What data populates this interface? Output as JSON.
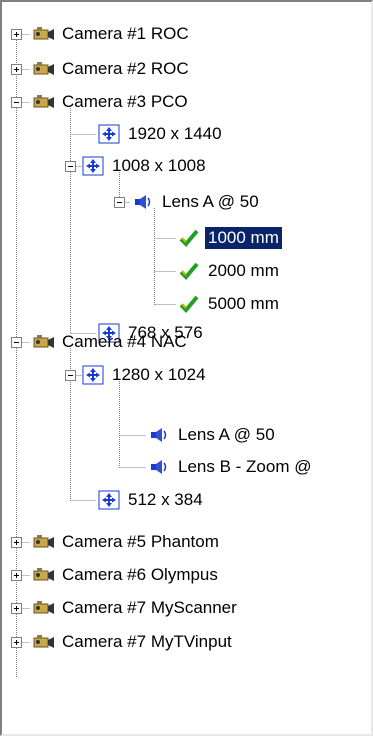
{
  "tree": {
    "cameras": [
      {
        "label": "Camera #1 ROC",
        "expanded": false
      },
      {
        "label": "Camera #2 ROC",
        "expanded": false
      },
      {
        "label": "Camera #3 PCO",
        "expanded": true,
        "resolutions": [
          {
            "label": "1920 x 1440"
          },
          {
            "label": "1008 x 1008",
            "expanded": true,
            "lenses": [
              {
                "label": "Lens A @ 50",
                "expanded": true,
                "distances": [
                  {
                    "label": "1000 mm",
                    "selected": true
                  },
                  {
                    "label": "2000 mm"
                  },
                  {
                    "label": "5000 mm"
                  }
                ]
              }
            ]
          },
          {
            "label": "768 x 576"
          }
        ]
      },
      {
        "label": "Camera #4 NAC",
        "expanded": true,
        "resolutions": [
          {
            "label": "1280 x 1024",
            "expanded": true,
            "lenses": [
              {
                "label": "Lens A @ 50"
              },
              {
                "label": "Lens B - Zoom @"
              }
            ]
          },
          {
            "label": "512 x 384"
          }
        ]
      },
      {
        "label": "Camera #5 Phantom",
        "expanded": false
      },
      {
        "label": "Camera #6 Olympus",
        "expanded": false
      },
      {
        "label": "Camera #7 MyScanner",
        "expanded": false
      },
      {
        "label": "Camera #7 MyTVinput",
        "expanded": false
      }
    ]
  },
  "colors": {
    "selection_bg": "#0a246a",
    "selection_fg": "#ffffff",
    "tree_line": "#808080",
    "check_green": "#22a022",
    "resolution_blue": "#1a3ad8"
  },
  "icons": {
    "camera": "camera-icon",
    "resolution": "resolution-move-icon",
    "lens": "lens-speaker-icon",
    "distance": "checkmark-icon"
  }
}
